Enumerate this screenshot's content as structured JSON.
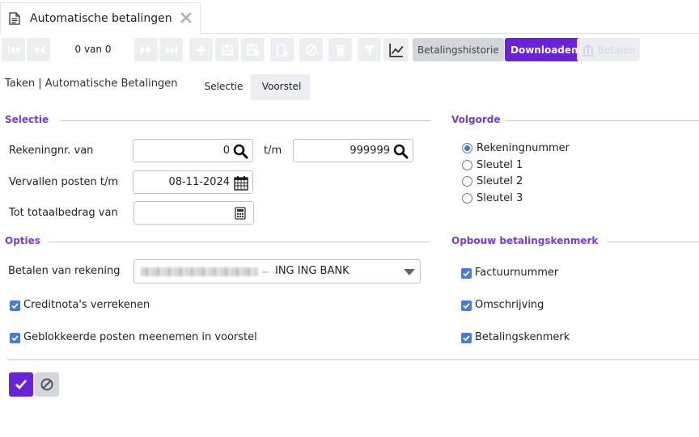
{
  "window": {
    "tab_title": "Automatische betalingen"
  },
  "toolbar": {
    "counter": "0 van 0",
    "history_label": "Betalingshistorie",
    "download_label": "Downloaden",
    "pay_label": "Betalen"
  },
  "breadcrumb": "Taken | Automatische Betalingen",
  "tabs": [
    {
      "label": "Selectie"
    },
    {
      "label": "Voorstel"
    }
  ],
  "selectie": {
    "heading": "Selectie",
    "rekeningnr_label": "Rekeningnr. van",
    "rekeningnr_from": "0",
    "tm_label": "t/m",
    "rekeningnr_to": "999999",
    "vervallen_label": "Vervallen posten t/m",
    "vervallen_value": "08-11-2024",
    "totaal_label": "Tot totaalbedrag van",
    "totaal_value": ""
  },
  "volgorde": {
    "heading": "Volgorde",
    "options": [
      "Rekeningnummer",
      "Sleutel 1",
      "Sleutel 2",
      "Sleutel 3"
    ],
    "selected": "Rekeningnummer"
  },
  "opties": {
    "heading": "Opties",
    "betalen_label": "Betalen van rekening",
    "betalen_value": "ING ING BANK",
    "creditnota_label": "Creditnota's verrekenen",
    "geblokkeerd_label": "Geblokkeerde posten meenemen in voorstel"
  },
  "kenmerk": {
    "heading": "Opbouw betalingskenmerk",
    "items": [
      "Factuurnummer",
      "Omschrijving",
      "Betalingskenmerk"
    ]
  },
  "colors": {
    "accent": "#6a22d9",
    "heading": "#7a3ad6",
    "check": "#4a7bd0"
  }
}
